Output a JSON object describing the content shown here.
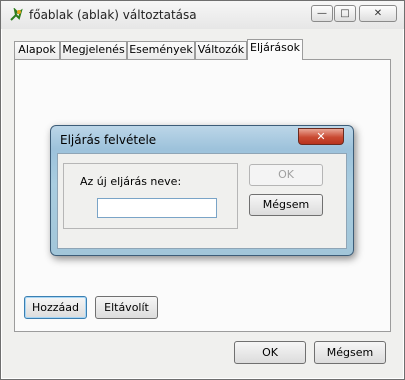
{
  "window": {
    "title": "főablak (ablak) változtatása"
  },
  "title_buttons": {
    "minimize": "—",
    "maximize": "□",
    "close": "✕"
  },
  "tabs": [
    {
      "label": "Alapok"
    },
    {
      "label": "Megjelenés"
    },
    {
      "label": "Események"
    },
    {
      "label": "Változók"
    },
    {
      "label": "Eljárások"
    }
  ],
  "active_tab": "Eljárások",
  "panel_buttons": {
    "add": "Hozzáad",
    "remove": "Eltávolít"
  },
  "footer_buttons": {
    "ok": "OK",
    "cancel": "Mégsem"
  },
  "dialog": {
    "title": "Eljárás felvétele",
    "close": "✕",
    "field_label": "Az új eljárás neve:",
    "field_value": "",
    "ok": "OK",
    "cancel": "Mégsem"
  }
}
